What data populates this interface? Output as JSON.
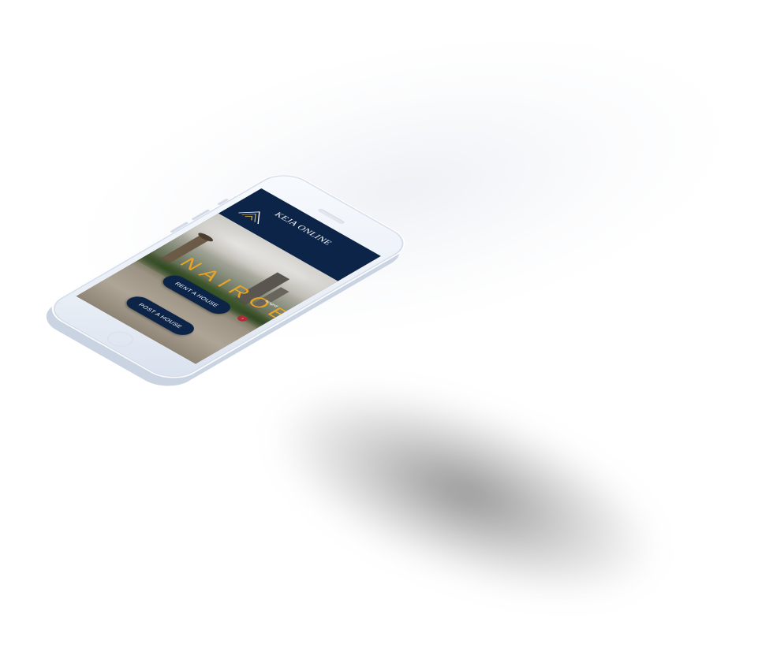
{
  "app": {
    "brand": "KEJA ONLINE",
    "logo_icon": "house-roof-chevron-icon"
  },
  "hero": {
    "city": "NAIROBI",
    "side_caption": "magnif",
    "arrow_icon": "chevron-right-icon"
  },
  "actions": {
    "rent_label": "RENT A HOUSE",
    "post_label": "POST A HOUSE"
  },
  "colors": {
    "navy": "#0c2448",
    "accent": "#f4a81d",
    "arrow_badge": "#b32a36"
  }
}
